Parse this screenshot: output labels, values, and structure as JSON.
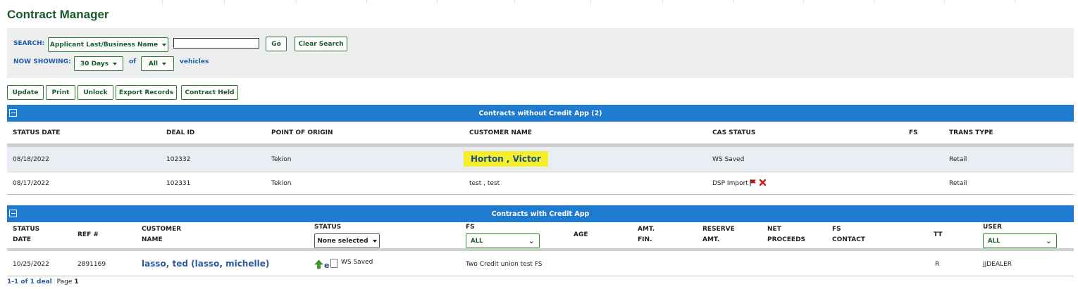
{
  "page": {
    "title": "Contract Manager"
  },
  "search": {
    "label": "SEARCH:",
    "field_select": "Applicant Last/Business Name",
    "input_value": "",
    "go": "Go",
    "clear": "Clear Search",
    "showing_label": "NOW SHOWING:",
    "days_select": "30 Days",
    "of": "of",
    "vehicles_select": "All",
    "vehicles": "vehicles"
  },
  "actions": {
    "update": "Update",
    "print": "Print",
    "unlock": "Unlock",
    "export": "Export Records",
    "held": "Contract Held"
  },
  "section1": {
    "title": "Contracts without Credit App (2)",
    "headers": {
      "status_date": "STATUS DATE",
      "deal_id": "DEAL ID",
      "origin": "POINT OF ORIGIN",
      "customer": "CUSTOMER NAME",
      "cas": "CAS STATUS",
      "fs": "FS",
      "trans": "TRANS TYPE"
    },
    "rows": [
      {
        "status_date": "08/18/2022",
        "deal_id": "102332",
        "origin": "Tekion",
        "customer": "Horton , Victor",
        "cas": "WS Saved",
        "fs": "",
        "trans": "Retail"
      },
      {
        "status_date": "08/17/2022",
        "deal_id": "102331",
        "origin": "Tekion",
        "customer": "test , test",
        "cas": "DSP Import",
        "fs": "",
        "trans": "Retail"
      }
    ],
    "icons": [
      "flag-icon",
      "delete-x-icon"
    ]
  },
  "section2": {
    "title": "Contracts with Credit App",
    "headers": {
      "status_date_1": "STATUS",
      "status_date_2": "DATE",
      "ref": "REF #",
      "customer_1": "CUSTOMER",
      "customer_2": "NAME",
      "status": "STATUS",
      "fs": "FS",
      "age": "AGE",
      "amt_1": "AMT.",
      "amt_2": "FIN.",
      "reserve_1": "RESERVE",
      "reserve_2": "AMT.",
      "net_1": "NET",
      "net_2": "PROCEEDS",
      "fsc_1": "FS",
      "fsc_2": "CONTACT",
      "tt": "TT",
      "user": "USER"
    },
    "filters": {
      "status": "None selected",
      "fs": "ALL",
      "user": "ALL"
    },
    "rows": [
      {
        "status_date": "10/25/2022",
        "ref": "2891169",
        "customer": "lasso, ted (lasso, michelle)",
        "status_icon_letter": "e",
        "status": "WS Saved",
        "fs": "Two Credit union test FS",
        "age": "",
        "amt": "",
        "reserve": "",
        "net": "",
        "contact": "",
        "tt": "R",
        "user": "JJDEALER"
      }
    ],
    "icons": [
      "arrow-up-icon",
      "edoc-icon",
      "document-icon"
    ]
  },
  "footer": {
    "range": "1-1 of 1 deal",
    "page_label": "Page",
    "page": "1"
  },
  "colors": {
    "title_green": "#1a5a2a",
    "section_blue": "#1f7bd0",
    "label_blue": "#245ea6",
    "highlight": "#f4ee2c"
  }
}
